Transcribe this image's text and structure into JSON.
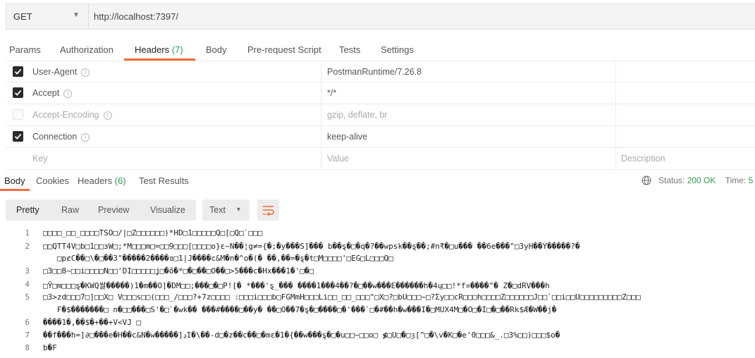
{
  "request": {
    "method": "GET",
    "url": "http://localhost:7397/"
  },
  "request_tabs": [
    {
      "label": "Params"
    },
    {
      "label": "Authorization"
    },
    {
      "label": "Headers",
      "count": "(7)",
      "active": true
    },
    {
      "label": "Body"
    },
    {
      "label": "Pre-request Script"
    },
    {
      "label": "Tests"
    },
    {
      "label": "Settings"
    }
  ],
  "headers": [
    {
      "key": "User-Agent",
      "value": "PostmanRuntime/7.26.8",
      "enabled": true
    },
    {
      "key": "Accept",
      "value": "*/*",
      "enabled": true
    },
    {
      "key": "Accept-Encoding",
      "value": "gzip, deflate, br",
      "enabled": false
    },
    {
      "key": "Connection",
      "value": "keep-alive",
      "enabled": true
    }
  ],
  "header_placeholders": {
    "key": "Key",
    "value": "Value",
    "description": "Description"
  },
  "response_tabs": [
    {
      "label": "Body",
      "active": true
    },
    {
      "label": "Cookies"
    },
    {
      "label": "Headers",
      "count": "(6)"
    },
    {
      "label": "Test Results"
    }
  ],
  "status": {
    "label": "Status:",
    "value": "200 OK",
    "time_label": "Time:",
    "time_value": "5"
  },
  "view_modes": [
    "Pretty",
    "Raw",
    "Preview",
    "Visualize"
  ],
  "format": "Text",
  "code_lines": [
    {
      "n": "1",
      "text": "□□□□_□□_□□□□TSO□/|□Z□□□□□□)*HD□1□□□□□Q□[□Q□`□□□"
    },
    {
      "n": "2",
      "text": "□□QTT4V□b□1□□ɜW□;*M□□□m□=□□9□□□[□□□□o}ɛ~N��¦g≠={�;�y���S]��� b��ȿ�□�q�?��wpsk��ȿ��;#n₹�□u��� ��6e���\"□3yH��Y�����?�"
    },
    {
      "n": "",
      "text": "   □pȼC��□\\�□��3\"�����2����ɞ□1|J����c&M�n�^o�(� ��,��=�ȿ�t□M□□□□'□EG□L□□□Q□"
    },
    {
      "n": "3",
      "text": "□3□□8~□□i□□□□N□□'DI□□□□□ʝ□�ő�*□�□��□O��□>5���c�Hx���1�'□�□"
    },
    {
      "n": "4",
      "text": "□Ŷ□m□□□ȿ�KWQ쌀�����)1�m��O]�DM□□;���□�□P![� *���'ȿ_��� ����1���4��?�□��w���E������h�4ų□□!*f¤����\"� Z�□dRV���h"
    },
    {
      "n": "5",
      "text": "□3>zd□□□7□]□□X□ V□□□s□□(□□□_/□□□?+7z□□□□ :□□□i□□□b□FGMmH□□□Li□□_□□_□□□\"□X□?□bU□□□~□?Σy□□cR□□□h□□□□Z□□□□□□J□□`□□i□□U□□□□□□□□□Z□□□"
    },
    {
      "n": "",
      "text": "   F�$�������□ n�□□���□S'�□`�wk�� ���#����□��y� ��□O��7�ȿ�□����□�'���`□�#��h�w���I�□MUX4M□�O□�I□�□��Rk$Æ�W��j�"
    },
    {
      "n": "6",
      "text": "����1�,��$�+��+V<VJ □"
    },
    {
      "n": "7",
      "text": "��f���h=]∂□���e�H��c&N�w�����]ڍI�\\��-d□�z��c��□�mɛ�1�{��w���ȿ�□�u□□~□□o□ ≸□U□�□ȝ[^□�\\v�K□�e'0□□□&_.□3%□□)□□□$o�"
    },
    {
      "n": "8",
      "text": "b�F"
    }
  ]
}
